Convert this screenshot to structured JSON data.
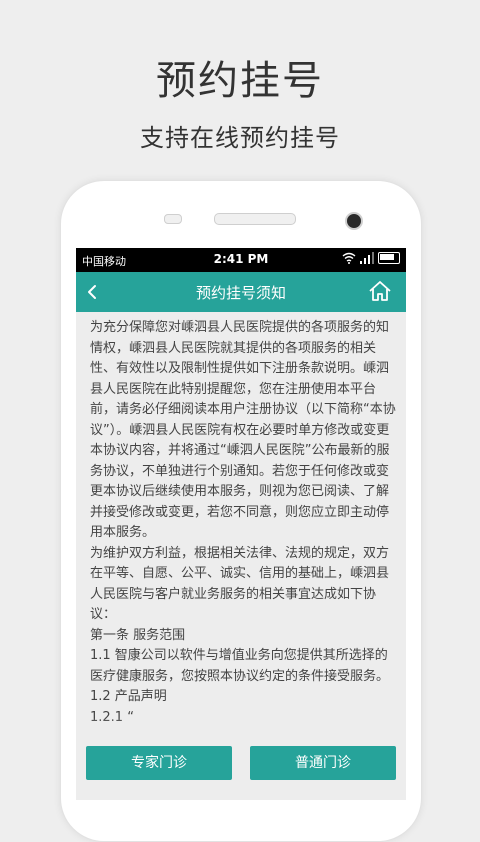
{
  "promo": {
    "title": "预约挂号",
    "subtitle": "支持在线预约挂号"
  },
  "statusbar": {
    "carrier": "中国移动",
    "time": "2:41 PM"
  },
  "navbar": {
    "title": "预约挂号须知"
  },
  "content": {
    "text": "为充分保障您对嵊泗县人民医院提供的各项服务的知情权，嵊泗县人民医院就其提供的各项服务的相关性、有效性以及限制性提供如下注册条款说明。嵊泗县人民医院在此特别提醒您，您在注册使用本平台前，请务必仔细阅读本用户注册协议（以下简称“本协议”）。嵊泗县人民医院有权在必要时单方修改或变更本协议内容，并将通过“嵊泗人民医院”公布最新的服务协议，不单独进行个别通知。若您于任何修改或变更本协议后继续使用本服务，则视为您已阅读、了解并接受修改或变更，若您不同意，则您应立即主动停用本服务。\n为维护双方利益，根据相关法律、法规的规定，双方在平等、自愿、公平、诚实、信用的基础上，嵊泗县人民医院与客户就业务服务的相关事宜达成如下协议：\n第一条 服务范围\n1.1 智康公司以软件与增值业务向您提供其所选择的医疗健康服务，您按照本协议约定的条件接受服务。\n1.2 产品声明\n1.2.1 “"
  },
  "buttons": {
    "expert": "专家门诊",
    "general": "普通门诊"
  },
  "icons": {
    "back": "back-arrow-icon",
    "home": "home-icon",
    "wifi": "wifi-icon",
    "signal": "signal-icon",
    "battery": "battery-icon"
  },
  "colors": {
    "accent": "#26a39a"
  }
}
